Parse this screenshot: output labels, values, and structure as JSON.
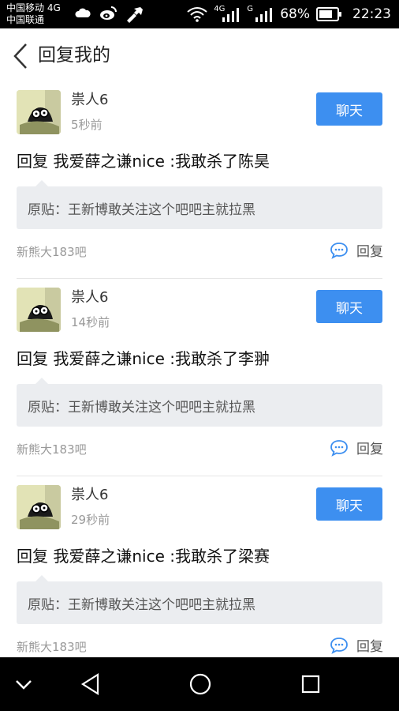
{
  "statusbar": {
    "carrier_line1": "中国移动 4G",
    "carrier_line2": "中国联通",
    "net1": "4G",
    "net2": "G",
    "battery": "68%",
    "time": "22:23"
  },
  "header": {
    "title": "回复我的"
  },
  "posts": [
    {
      "username": "祟人6",
      "time": "5秒前",
      "chat_label": "聊天",
      "reply": "回复 我爱薛之谦nice :我敢杀了陈昊",
      "quote": "原贴：王新博敢关注这个吧吧主就拉黑",
      "forum": "新熊大183吧",
      "reply_label": "回复"
    },
    {
      "username": "祟人6",
      "time": "14秒前",
      "chat_label": "聊天",
      "reply": "回复 我爱薛之谦nice :我敢杀了李翀",
      "quote": "原贴：王新博敢关注这个吧吧主就拉黑",
      "forum": "新熊大183吧",
      "reply_label": "回复"
    },
    {
      "username": "祟人6",
      "time": "29秒前",
      "chat_label": "聊天",
      "reply": "回复 我爱薛之谦nice :我敢杀了梁赛",
      "quote": "原贴：王新博敢关注这个吧吧主就拉黑",
      "forum": "新熊大183吧",
      "reply_label": "回复"
    }
  ],
  "colors": {
    "accent": "#3d8ff0",
    "quote_bg": "#ebedf0"
  },
  "icons": {
    "back": "chevron-left-icon",
    "reply": "speech-bubble-icon",
    "nav": [
      "chevron-down-icon",
      "back-triangle-icon",
      "home-circle-icon",
      "recents-square-icon"
    ]
  }
}
